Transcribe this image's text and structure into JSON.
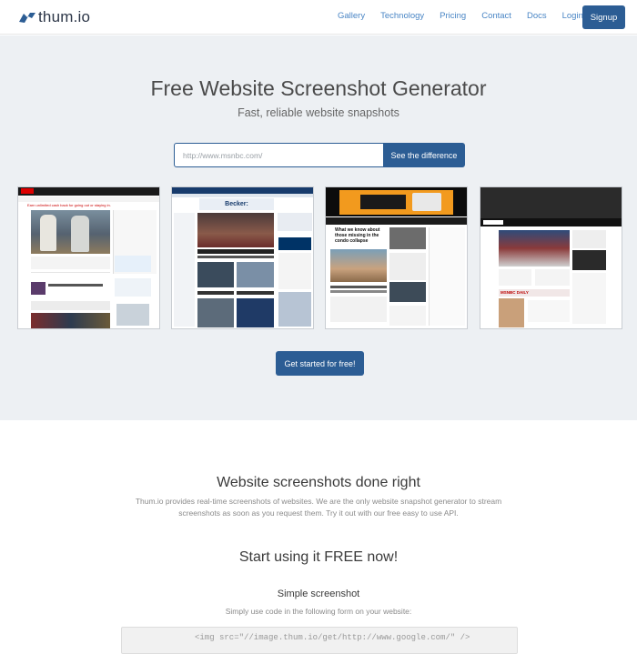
{
  "nav": {
    "logo_text": "thum.io",
    "links": [
      "Gallery",
      "Technology",
      "Pricing",
      "Contact",
      "Docs",
      "Login"
    ],
    "signup_label": "Signup"
  },
  "hero": {
    "title": "Free Website Screenshot Generator",
    "subtitle": "Fast, reliable website snapshots",
    "url_placeholder": "http://www.msnbc.com/",
    "compare_button": "See the difference",
    "cta_button": "Get started for free!",
    "screenshots": [
      {
        "site": "ESPN",
        "headline": "Earn unlimited cash back for going out or staying in."
      },
      {
        "site": "Fox News",
        "headline": "Becker:"
      },
      {
        "site": "CNN",
        "headline": "What we know about those missing in the condo collapse"
      },
      {
        "site": "MSNBC",
        "headline": "MSNBC DAILY"
      }
    ]
  },
  "features": {
    "title": "Website screenshots done right",
    "description": "Thum.io provides real-time screenshots of websites. We are the only website snapshot generator to stream screenshots as soon as you request them. Try it out with our free easy to use API.",
    "free_title": "Start using it FREE now!",
    "simple_title": "Simple screenshot",
    "simple_desc": "Simply use code in the following form on your website:",
    "code_sample": "<img src=\"//image.thum.io/get/http://www.google.com/\" />"
  },
  "colors": {
    "primary": "#2c5d94",
    "link": "#4a86c5",
    "hero_bg": "#edf0f3"
  }
}
